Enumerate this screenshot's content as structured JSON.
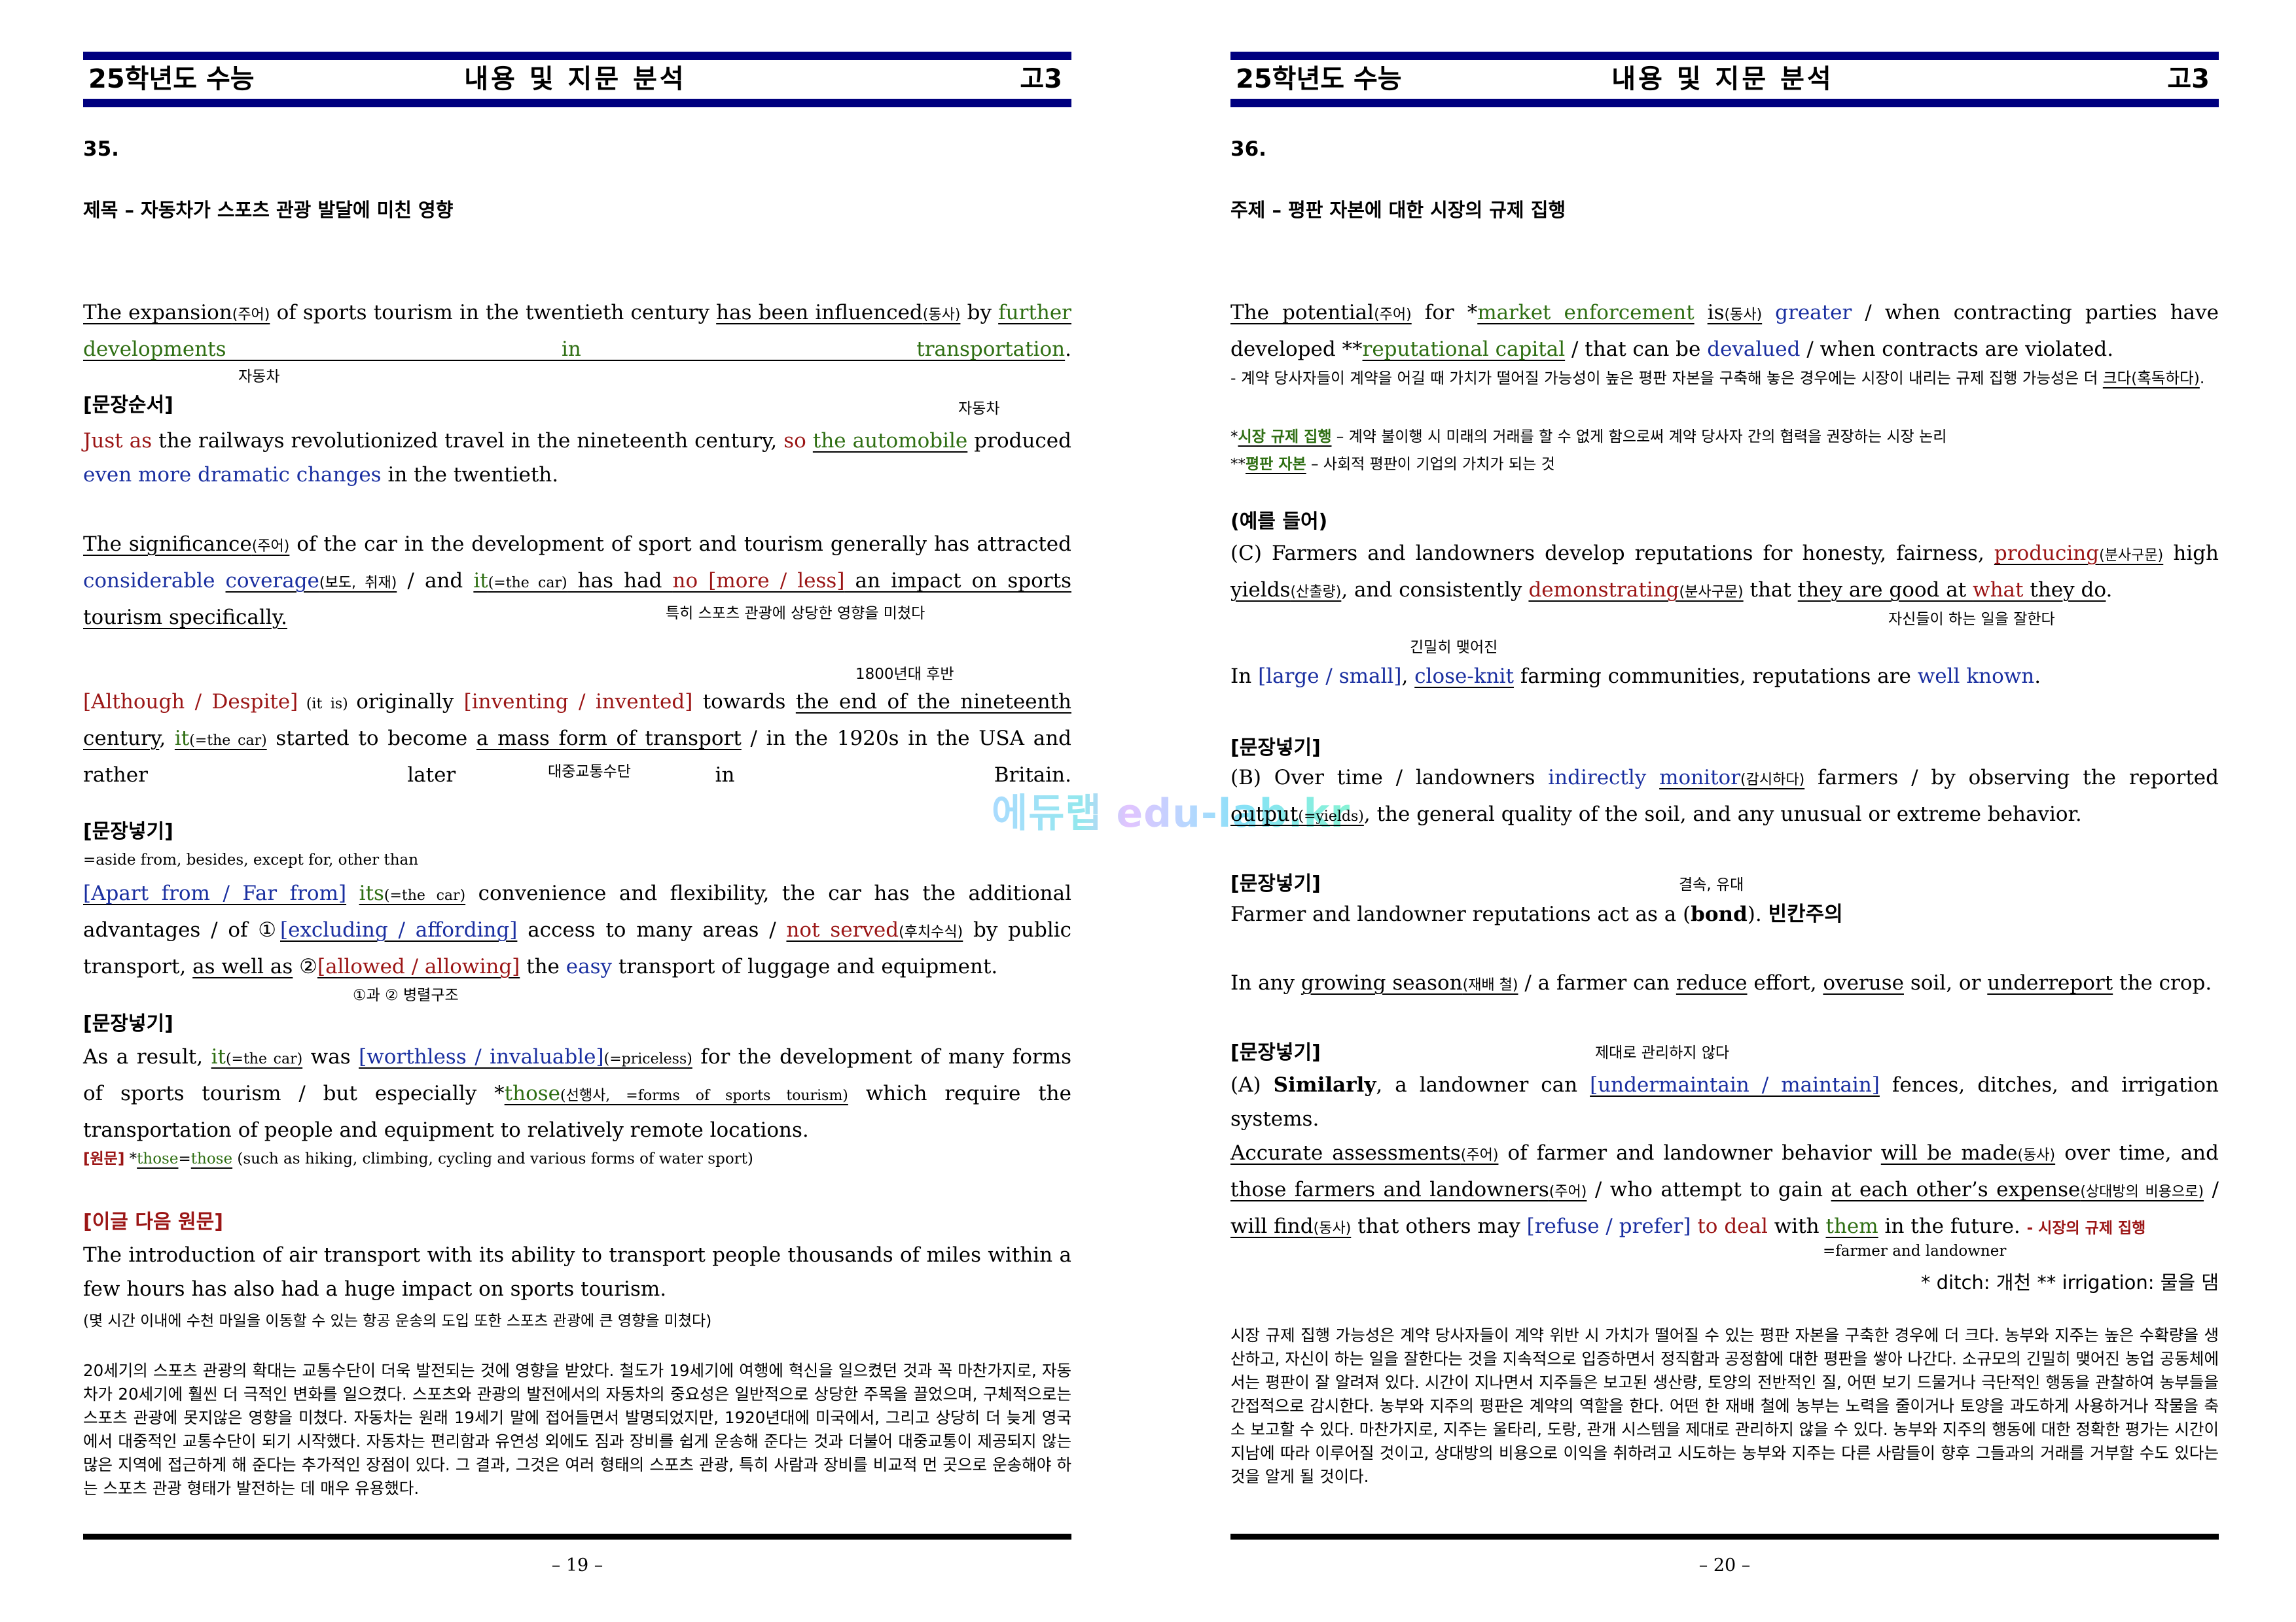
{
  "header": {
    "left": "25학년도 수능",
    "center": "내용 및 지문 분석",
    "right": "고3"
  },
  "watermark": "에듀랩 edu-lab.kr",
  "left_page": {
    "question_number": "35.",
    "title": "제목 – 자동차가 스포츠 관광 발달에 미친 영향",
    "p1": {
      "s1": "The expansion",
      "s1_ann": "(주어)",
      "s2": " of sports tourism in the twentieth century ",
      "s3": "has been influenced",
      "s3_ann": "(동사)",
      "s4": " by ",
      "s5": "further developments in transportation",
      "s6": "."
    },
    "note_car1": "자동차",
    "note_car2": "자동차",
    "tag_order": "[문장순서]",
    "p2": {
      "a": "Just as",
      "b": " the railways revolutionized travel in the nineteenth century, ",
      "c": "so",
      "d": " ",
      "e": "the automobile",
      "f": " produced ",
      "g": "even more dramatic changes",
      "h": " in the twentieth."
    },
    "p3": {
      "a": "The significance",
      "a_ann": "(주어)",
      "b": " of the car in the development of sport and tourism generally has attracted ",
      "c": "considerable",
      "d": " ",
      "e": "coverage",
      "e_ann": "(보도, 취재)",
      "f": " / and ",
      "g": "it",
      "g_ann": "(=the car)",
      "h": " has had ",
      "i": "no [more / less]",
      "j": " an impact on sports tourism specifically."
    },
    "note_p3": "특히 스포츠 관광에 상당한 영향을 미쳤다",
    "note_1800": "1800년대 후반",
    "p4": {
      "a": "[Although / Despite]",
      "b": " (it is) ",
      "c": "originally ",
      "d": "[inventing / invented]",
      "e": " towards ",
      "f": "the end of the nineteenth century",
      "g": ", ",
      "h": "it",
      "h_ann": "(=the car)",
      "i": " started to become ",
      "j": "a mass form of transport",
      "k": " / in the 1920s in the USA and rather later in Britain."
    },
    "note_mass": "대중교통수단",
    "tag_insert1": "[문장넣기]",
    "note_aside": "=aside from, besides, except for, other than",
    "p5": {
      "a": "[Apart from / Far from]",
      "b": " ",
      "c": "its",
      "c_ann": "(=the car)",
      "d": " convenience and flexibility, the car has the additional advantages / of ",
      "e": "①",
      "f": "[excluding / affording]",
      "g": " access to many areas / ",
      "h": "not served",
      "h_ann": "(후치수식)",
      "i": " by public transport, ",
      "j": "as well as",
      "k": " ②",
      "l": "[allowed / allowing]",
      "m": " the ",
      "n": "easy",
      "o": " transport of luggage and equipment."
    },
    "note_parallel": "①과 ② 병렬구조",
    "tag_insert2": "[문장넣기]",
    "p6": {
      "a": "As a result, ",
      "b": "it",
      "b_ann": "(=the car)",
      "c": " was ",
      "d": "[worthless / invaluable]",
      "d_ann": "(=priceless)",
      "e": " for the development of many forms of sports tourism / but especially *",
      "f": "those",
      "f_ann": "(선행사, =forms of sports tourism)",
      "g": " which require the transportation of people and equipment to relatively remote locations."
    },
    "original": {
      "tag": "[원문]",
      "star": " *",
      "a": "those",
      "eq": "=",
      "b": "those",
      "c": " (such as hiking, climbing, cycling and various forms of water sport)"
    },
    "next_tag": "[이글 다음 원문]",
    "next_en": "The introduction of air transport with its ability to transport people thousands of miles within a few hours has also had a huge impact on sports tourism.",
    "next_ko": "(몇 시간 이내에 수천 마일을 이동할 수 있는 항공 운송의 도입 또한 스포츠 관광에 큰 영향을 미쳤다)",
    "summary": "20세기의 스포츠 관광의 확대는 교통수단이 더욱 발전되는 것에 영향을 받았다. 철도가 19세기에 여행에 혁신을 일으켰던 것과 꼭 마찬가지로, 자동차가 20세기에 훨씬 더 극적인 변화를 일으켰다. 스포츠와 관광의 발전에서의 자동차의 중요성은 일반적으로 상당한 주목을 끌었으며, 구체적으로는 스포츠 관광에 못지않은 영향을 미쳤다. 자동차는 원래 19세기 말에 접어들면서 발명되었지만, 1920년대에 미국에서, 그리고 상당히 더 늦게 영국에서 대중적인 교통수단이 되기 시작했다. 자동차는 편리함과 유연성 외에도 짐과 장비를 쉽게 운송해 준다는 것과 더불어 대중교통이 제공되지 않는 많은 지역에 접근하게 해 준다는 추가적인 장점이 있다. 그 결과, 그것은 여러 형태의 스포츠 관광, 특히 사람과 장비를 비교적 먼 곳으로 운송해야 하는 스포츠 관광 형태가 발전하는 데 매우 유용했다.",
    "page_number": "– 19 –"
  },
  "right_page": {
    "question_number": "36.",
    "title": "주제 – 평판 자본에 대한 시장의 규제 집행",
    "p1": {
      "a": "The potential",
      "a_ann": "(주어)",
      "b": " for *",
      "c": "market enforcement",
      "d": " ",
      "e": "is",
      "e_ann": "(동사)",
      "f": " ",
      "g": "greater",
      "h": " / when contracting parties have developed **",
      "i": "reputational capital",
      "j": " / that can be ",
      "k": "devalued",
      "l": " / when contracts are violated."
    },
    "p1_ko_a": "- 계약 당사자들이 계약을 어길 때 가치가 떨어질 가능성이 높은 평판 자본을 구축해 놓은 경우에는 시장이 내리는 규제 집행 가능성은 더 ",
    "p1_ko_b": "크다(혹독하다)",
    "p1_ko_c": ".",
    "def1": {
      "star": "*",
      "term": "시장 규제 집행",
      "desc": " – 계약 불이행 시 미래의 거래를 할 수 없게 함으로써 계약 당사자 간의 협력을 권장하는 시장 논리"
    },
    "def2": {
      "star": "**",
      "term": "평판 자본",
      "desc": " – 사회적 평판이 기업의 가치가 되는 것"
    },
    "tag_example": "(예를 들어)",
    "p2": {
      "a": "(C) Farmers and landowners develop reputations for honesty, fairness, ",
      "b": "producing",
      "b_ann": "(분사구문)",
      "c": " high ",
      "d": "yields",
      "d_ann": "(산출량)",
      "e": ", and consistently ",
      "f": "demonstrating",
      "f_ann": "(분사구문)",
      "g": " that ",
      "h1": "they are good at ",
      "h2": "what",
      "h3": " they do",
      "i": "."
    },
    "note_good": "자신들이 하는 일을 잘한다",
    "note_closeknit": "긴밀히 맺어진",
    "p3": {
      "a": "In ",
      "b": "[large / small]",
      "c": ", ",
      "d": "close-knit",
      "e": " farming communities, reputations are ",
      "f": "well known",
      "g": "."
    },
    "tag_insert1": "[문장넣기]",
    "p4": {
      "a": "(B) Over time / landowners ",
      "b": "indirectly",
      "c": " ",
      "d": "monitor",
      "d_ann": "(감시하다)",
      "e": " farmers / by observing the reported ",
      "f": "output",
      "f_ann": "(=yields)",
      "g": ", the general quality of the soil, and any unusual or extreme behavior."
    },
    "tag_insert2": "[문장넣기]",
    "note_bond": "결속, 유대",
    "p5": {
      "a": "Farmer and landowner reputations act as a (",
      "b": "bond",
      "c": "). ",
      "d": "빈칸주의"
    },
    "p6": {
      "a": "In any ",
      "b": "growing season",
      "b_ann": "(재배 철)",
      "c": " / a farmer can ",
      "d": "reduce",
      "e": " effort, ",
      "f": "overuse",
      "g": " soil, or ",
      "h": "underreport",
      "i": " the crop."
    },
    "tag_insert3": "[문장넣기]",
    "note_undermaintain": "제대로 관리하지 않다",
    "p7": {
      "a": "(A) ",
      "b": "Similarly",
      "c": ", a landowner can ",
      "d": "[undermaintain / maintain]",
      "e": " fences, ditches, and irrigation systems."
    },
    "p8": {
      "a": "Accurate assessments",
      "a_ann": "(주어)",
      "b": " of farmer and landowner behavior ",
      "c": "will be made",
      "c_ann": "(동사)",
      "d": " over time, and ",
      "e": "those farmers and landowners",
      "e_ann": "(주어)",
      "f": " / who attempt to gain ",
      "g": "at each other’s expense",
      "g_ann": "(상대방의 비용으로)",
      "h": " / ",
      "i": "will find",
      "i_ann": "(동사)",
      "j": " that others may ",
      "k": "[refuse / prefer]",
      "l": " ",
      "m": "to deal",
      "n": " with ",
      "o": "them",
      "p": " in the future. ",
      "q": "- 시장의 규제 집행"
    },
    "note_them": "=farmer and landowner",
    "glossary": "* ditch: 개천 ** irrigation: 물을 댐",
    "summary": "시장 규제 집행 가능성은 계약 당사자들이 계약 위반 시 가치가 떨어질 수 있는 평판 자본을 구축한 경우에 더 크다. 농부와 지주는 높은 수확량을 생산하고, 자신이 하는 일을 잘한다는 것을 지속적으로 입증하면서 정직함과 공정함에 대한 평판을 쌓아 나간다. 소규모의 긴밀히 맺어진 농업 공동체에서는 평판이 잘 알려져 있다. 시간이 지나면서 지주들은 보고된 생산량, 토양의 전반적인 질, 어떤 보기 드물거나 극단적인 행동을 관찰하여 농부들을 간접적으로 감시한다. 농부와 지주의 평판은 계약의 역할을 한다. 어떤 한 재배 철에 농부는 노력을 줄이거나 토양을 과도하게 사용하거나 작물을 축소 보고할 수 있다. 마찬가지로, 지주는 울타리, 도랑, 관개 시스템을 제대로 관리하지 않을 수 있다. 농부와 지주의 행동에 대한 정확한 평가는 시간이 지남에 따라 이루어질 것이고, 상대방의 비용으로 이익을 취하려고 시도하는 농부와 지주는 다른 사람들이 향후 그들과의 거래를 거부할 수도 있다는 것을 알게 될 것이다.",
    "page_number": "– 20 –"
  }
}
